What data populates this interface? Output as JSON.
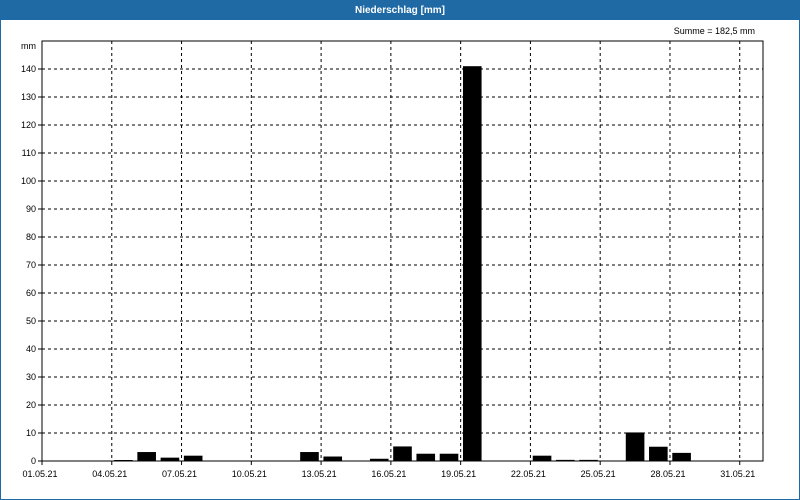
{
  "window": {
    "title": "Niederschlag [mm]"
  },
  "summary": {
    "text": "Summe = 182,5 mm"
  },
  "colors": {
    "titlebar": "#1f6aa5",
    "bar": "#000000",
    "grid": "#000000"
  },
  "chart_data": {
    "type": "bar",
    "title": "Niederschlag [mm]",
    "ylabel": "mm",
    "xlabel": "",
    "ylim": [
      0,
      150
    ],
    "yticks": [
      0,
      10,
      20,
      30,
      40,
      50,
      60,
      70,
      80,
      90,
      100,
      110,
      120,
      130,
      140
    ],
    "xticks": [
      "01.05.21",
      "04.05.21",
      "07.05.21",
      "10.05.21",
      "13.05.21",
      "16.05.21",
      "19.05.21",
      "22.05.21",
      "25.05.21",
      "28.05.21",
      "31.05.21"
    ],
    "grid": true,
    "categories": [
      "01.05.21",
      "02.05.21",
      "03.05.21",
      "04.05.21",
      "05.05.21",
      "06.05.21",
      "07.05.21",
      "08.05.21",
      "09.05.21",
      "10.05.21",
      "11.05.21",
      "12.05.21",
      "13.05.21",
      "14.05.21",
      "15.05.21",
      "16.05.21",
      "17.05.21",
      "18.05.21",
      "19.05.21",
      "20.05.21",
      "21.05.21",
      "22.05.21",
      "23.05.21",
      "24.05.21",
      "25.05.21",
      "26.05.21",
      "27.05.21",
      "28.05.21",
      "29.05.21",
      "30.05.21",
      "31.05.21"
    ],
    "values": [
      0,
      0,
      0,
      0.3,
      3.2,
      1.2,
      1.9,
      0,
      0,
      0,
      0,
      3.2,
      1.6,
      0,
      0.8,
      5.2,
      2.6,
      2.6,
      141,
      0,
      0,
      1.9,
      0.4,
      0.4,
      0,
      10.2,
      5.1,
      2.9,
      0,
      0,
      0
    ]
  }
}
